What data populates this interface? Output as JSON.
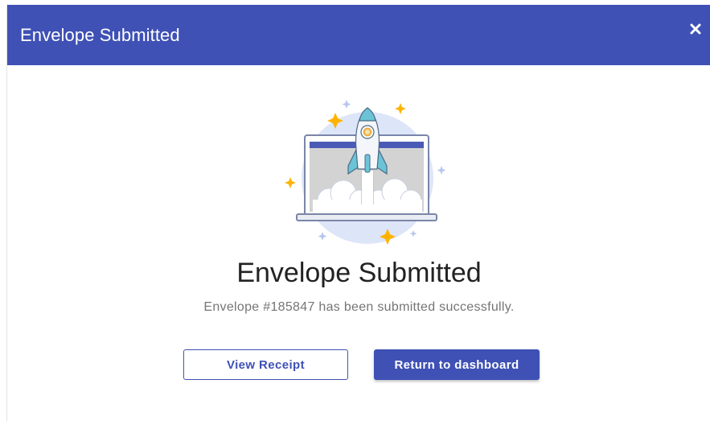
{
  "dialog": {
    "title": "Envelope Submitted",
    "close_icon": "close-icon"
  },
  "main": {
    "illustration": "rocket-launch-laptop-illustration",
    "heading": "Envelope Submitted",
    "message": "Envelope #185847 has been submitted successfully."
  },
  "actions": {
    "view_receipt_label": "View Receipt",
    "return_label": "Return to dashboard"
  },
  "colors": {
    "primary": "#3f51b5",
    "accent_star": "#ffb300",
    "rocket_teal": "#6bc3d6",
    "light_circle": "#d9e1f7"
  }
}
